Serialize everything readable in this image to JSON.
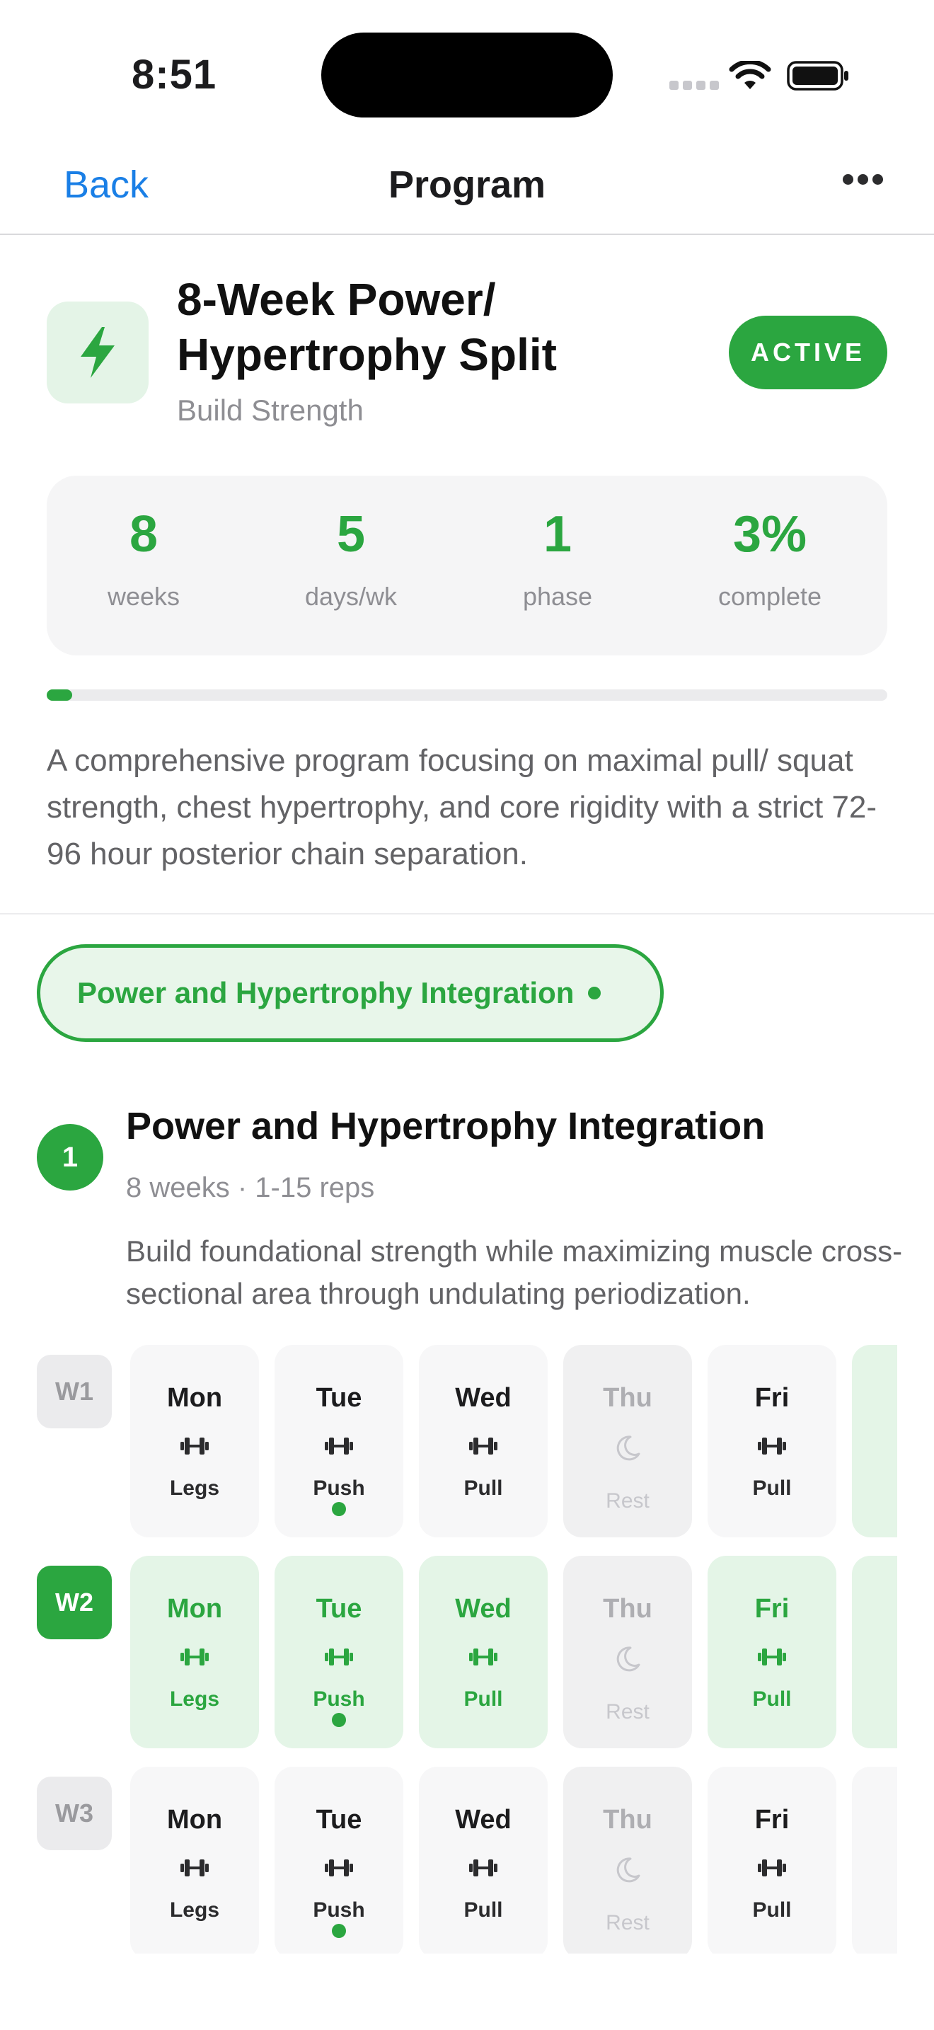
{
  "status_bar": {
    "time": "8:51"
  },
  "nav": {
    "back_label": "Back",
    "title": "Program",
    "more_icon": "ellipsis-icon"
  },
  "program": {
    "icon": "bolt-icon",
    "title": "8-Week Power/ Hypertrophy Split",
    "subtitle": "Build Strength",
    "status_badge": "ACTIVE",
    "stats": [
      {
        "value": "8",
        "label": "weeks"
      },
      {
        "value": "5",
        "label": "days/wk"
      },
      {
        "value": "1",
        "label": "phase"
      },
      {
        "value": "3%",
        "label": "complete"
      }
    ],
    "progress_fraction": 0.03,
    "description": "A comprehensive program focusing on maximal pull/ squat strength, chest hypertrophy, and core rigidity with a strict 72-96 hour posterior chain separation."
  },
  "phase_chip": {
    "label": "Power and Hypertrophy Integration"
  },
  "phase": {
    "number": "1",
    "title": "Power and Hypertrophy Integration",
    "meta": "8 weeks · 1-15 reps",
    "description": "Build foundational strength while maximizing muscle cross-sectional area through undulating periodization."
  },
  "colors": {
    "accent": "#2ba640",
    "accent_light": "#e4f5e7",
    "link": "#1a7fe6",
    "muted": "#8e8e93"
  },
  "weeks": [
    {
      "label": "W1",
      "current": false,
      "days": [
        {
          "name": "Mon",
          "type": "Legs",
          "icon": "dumbbell-icon",
          "rest": false,
          "today": false
        },
        {
          "name": "Tue",
          "type": "Push",
          "icon": "dumbbell-icon",
          "rest": false,
          "today": true
        },
        {
          "name": "Wed",
          "type": "Pull",
          "icon": "dumbbell-icon",
          "rest": false,
          "today": false
        },
        {
          "name": "Thu",
          "type": "Rest",
          "icon": "moon-icon",
          "rest": true,
          "today": false
        },
        {
          "name": "Fri",
          "type": "Pull",
          "icon": "dumbbell-icon",
          "rest": false,
          "today": false
        }
      ]
    },
    {
      "label": "W2",
      "current": true,
      "days": [
        {
          "name": "Mon",
          "type": "Legs",
          "icon": "dumbbell-icon",
          "rest": false,
          "today": false
        },
        {
          "name": "Tue",
          "type": "Push",
          "icon": "dumbbell-icon",
          "rest": false,
          "today": true
        },
        {
          "name": "Wed",
          "type": "Pull",
          "icon": "dumbbell-icon",
          "rest": false,
          "today": false
        },
        {
          "name": "Thu",
          "type": "Rest",
          "icon": "moon-icon",
          "rest": true,
          "today": false
        },
        {
          "name": "Fri",
          "type": "Pull",
          "icon": "dumbbell-icon",
          "rest": false,
          "today": false
        }
      ]
    },
    {
      "label": "W3",
      "current": false,
      "days": [
        {
          "name": "Mon",
          "type": "Legs",
          "icon": "dumbbell-icon",
          "rest": false,
          "today": false
        },
        {
          "name": "Tue",
          "type": "Push",
          "icon": "dumbbell-icon",
          "rest": false,
          "today": true
        },
        {
          "name": "Wed",
          "type": "Pull",
          "icon": "dumbbell-icon",
          "rest": false,
          "today": false
        },
        {
          "name": "Thu",
          "type": "Rest",
          "icon": "moon-icon",
          "rest": true,
          "today": false
        },
        {
          "name": "Fri",
          "type": "Pull",
          "icon": "dumbbell-icon",
          "rest": false,
          "today": false
        }
      ]
    }
  ]
}
